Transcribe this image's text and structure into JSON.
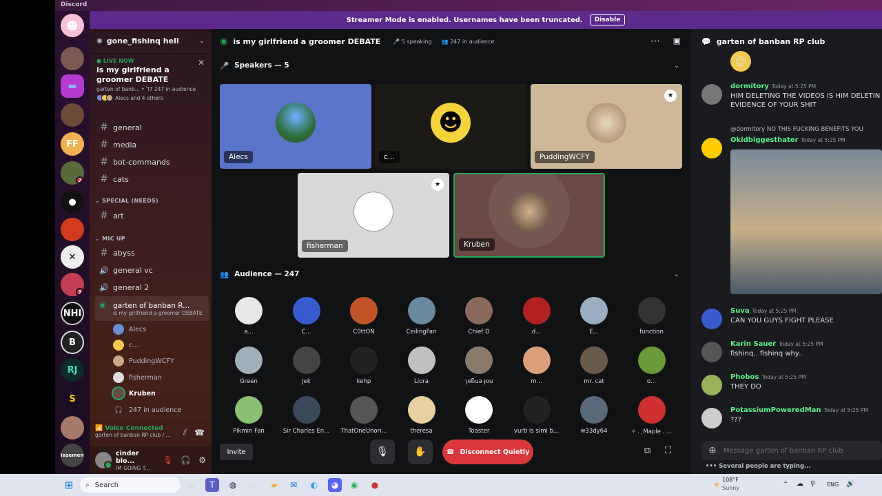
{
  "app": {
    "title": "Discord"
  },
  "banner": {
    "text": "Streamer Mode is enabled. Usernames have been truncated.",
    "button": "Disable"
  },
  "server": {
    "name": "gone_fishinq hell"
  },
  "live": {
    "label": "LIVE NOW",
    "title": "is my girlfriend a groomer DEBATE",
    "meta": "garten of banb... • Ἲ7 247 in audience",
    "others": "Alecs and 4 others"
  },
  "channels": [
    {
      "name": "general",
      "type": "text"
    },
    {
      "name": "media",
      "type": "text"
    },
    {
      "name": "bot-commands",
      "type": "text"
    },
    {
      "name": "cats",
      "type": "text"
    }
  ],
  "cat_special": "SPECIAL (NEEDS)",
  "ch_art": "art",
  "cat_micup": "MIC UP",
  "micup_channels": [
    {
      "name": "abyss",
      "type": "text"
    },
    {
      "name": "general vc",
      "type": "voice"
    },
    {
      "name": "general 2",
      "type": "voice"
    }
  ],
  "stage_channel": {
    "name": "garten of banban R...",
    "sub": "is my girlfriend a groomer DEBATE"
  },
  "voice_users": [
    "Alecs",
    "c...",
    "PuddingWCFY",
    "fisherman",
    "Kruben",
    "247 in audience"
  ],
  "voice_connected": {
    "title": "Voice Connected",
    "sub": "garten of banban RP club / ..."
  },
  "user": {
    "name": "cinder blo...",
    "status": "IM GOING T..."
  },
  "stage": {
    "title": "is my girlfriend a groomer DEBATE",
    "speaking": "5 speaking",
    "audience_count": "247 in audience",
    "speakers_label": "Speakers — 5",
    "audience_label": "Audience — 247"
  },
  "speakers": [
    {
      "name": "Alecs",
      "color": "#5a74c9"
    },
    {
      "name": "c...",
      "color": "#1c1a17"
    },
    {
      "name": "PuddingWCFY",
      "color": "#cdb89a"
    },
    {
      "name": "fisherman",
      "color": "#d9d9d9"
    },
    {
      "name": "Kruben",
      "color": "#6b4a45"
    }
  ],
  "audience": [
    [
      "a...",
      "C...",
      "C0ttON",
      "CeilingFan",
      "Chief D",
      "d...",
      "E...",
      "function"
    ],
    [
      "Green",
      "Jek",
      "kehp",
      "Liora",
      "ʅɐƃuǝ ɟou",
      "m...",
      "mr. cat",
      "o..."
    ],
    [
      "Pikmin Fan",
      "Sir Charles En...",
      "ThatOneUnori...",
      "theresa",
      "Toaster",
      "vurb is simi b...",
      "w33dy64",
      "✧ . ͙ Maple . ..."
    ]
  ],
  "controls": {
    "invite": "Invite",
    "disconnect": "Disconnect Quietly"
  },
  "chat": {
    "channel": "garten of banban RP club",
    "messages": [
      {
        "author": "dormitory",
        "time": "Today at 5:25 PM",
        "text": "HIM DELETING THE VIDEOS IS HIM DELETIN",
        "text2": "EVIDENCE OF YOUR SHIT",
        "color": "#57f287"
      },
      {
        "author": "Okidbiggesthater",
        "time": "Today at 5:25 PM",
        "reply": "@dormitory NO THIS FUCKING BENEFITS YOU",
        "color": "#57f287"
      },
      {
        "author": "Suva",
        "time": "Today at 5:25 PM",
        "text": "CAN YOU GUYS FIGHT PLEASE",
        "color": "#57f287"
      },
      {
        "author": "Karin Sauer",
        "time": "Today at 5:25 PM",
        "text": "fishinq..  fishinq why..",
        "color": "#57f287"
      },
      {
        "author": "Phobos",
        "time": "Today at 5:25 PM",
        "text": "THEY DO",
        "color": "#57f287"
      },
      {
        "author": "PotassiumPoweredMan",
        "time": "Today at 5:25 PM",
        "text": "???",
        "color": "#57f287"
      }
    ],
    "input_placeholder": "Message garten of banban RP club",
    "typing": "Several people are typing..."
  },
  "taskbar": {
    "search": "Search",
    "weather_temp": "108°F",
    "weather_desc": "Sunny",
    "lang": "ENG"
  }
}
